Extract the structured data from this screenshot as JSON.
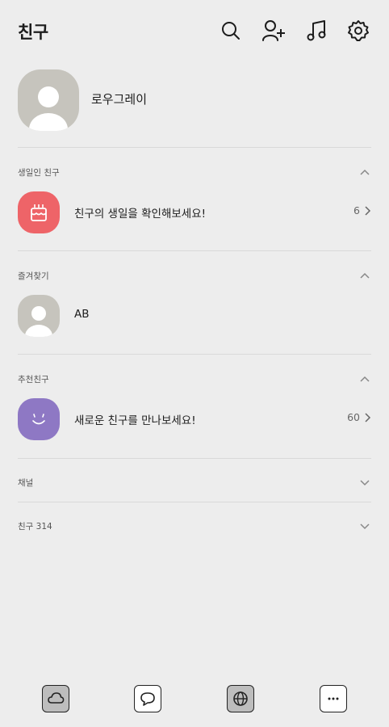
{
  "header": {
    "title": "친구",
    "icons": [
      "search-icon",
      "add-friend-icon",
      "music-icon",
      "settings-icon"
    ]
  },
  "profile": {
    "name": "로우그레이"
  },
  "sections": {
    "birthday": {
      "label": "생일인 친구",
      "row_text": "친구의 생일을 확인해보세요!",
      "count": "6"
    },
    "favorites": {
      "label": "즐겨찾기",
      "row_text": "AB"
    },
    "recommended": {
      "label": "추천친구",
      "row_text": "새로운 친구를 만나보세요!",
      "count": "60"
    },
    "channel": {
      "label": "채널"
    },
    "friends": {
      "label": "친구 314"
    }
  },
  "colors": {
    "background": "#ededed",
    "birthday_icon": "#ee6468",
    "recommend_icon": "#8e78c4",
    "avatar": "#c6c4bd",
    "nav_fill": "#bdbdbd"
  },
  "bottom_nav": [
    "cloud-icon",
    "chat-icon",
    "globe-icon",
    "more-icon"
  ]
}
